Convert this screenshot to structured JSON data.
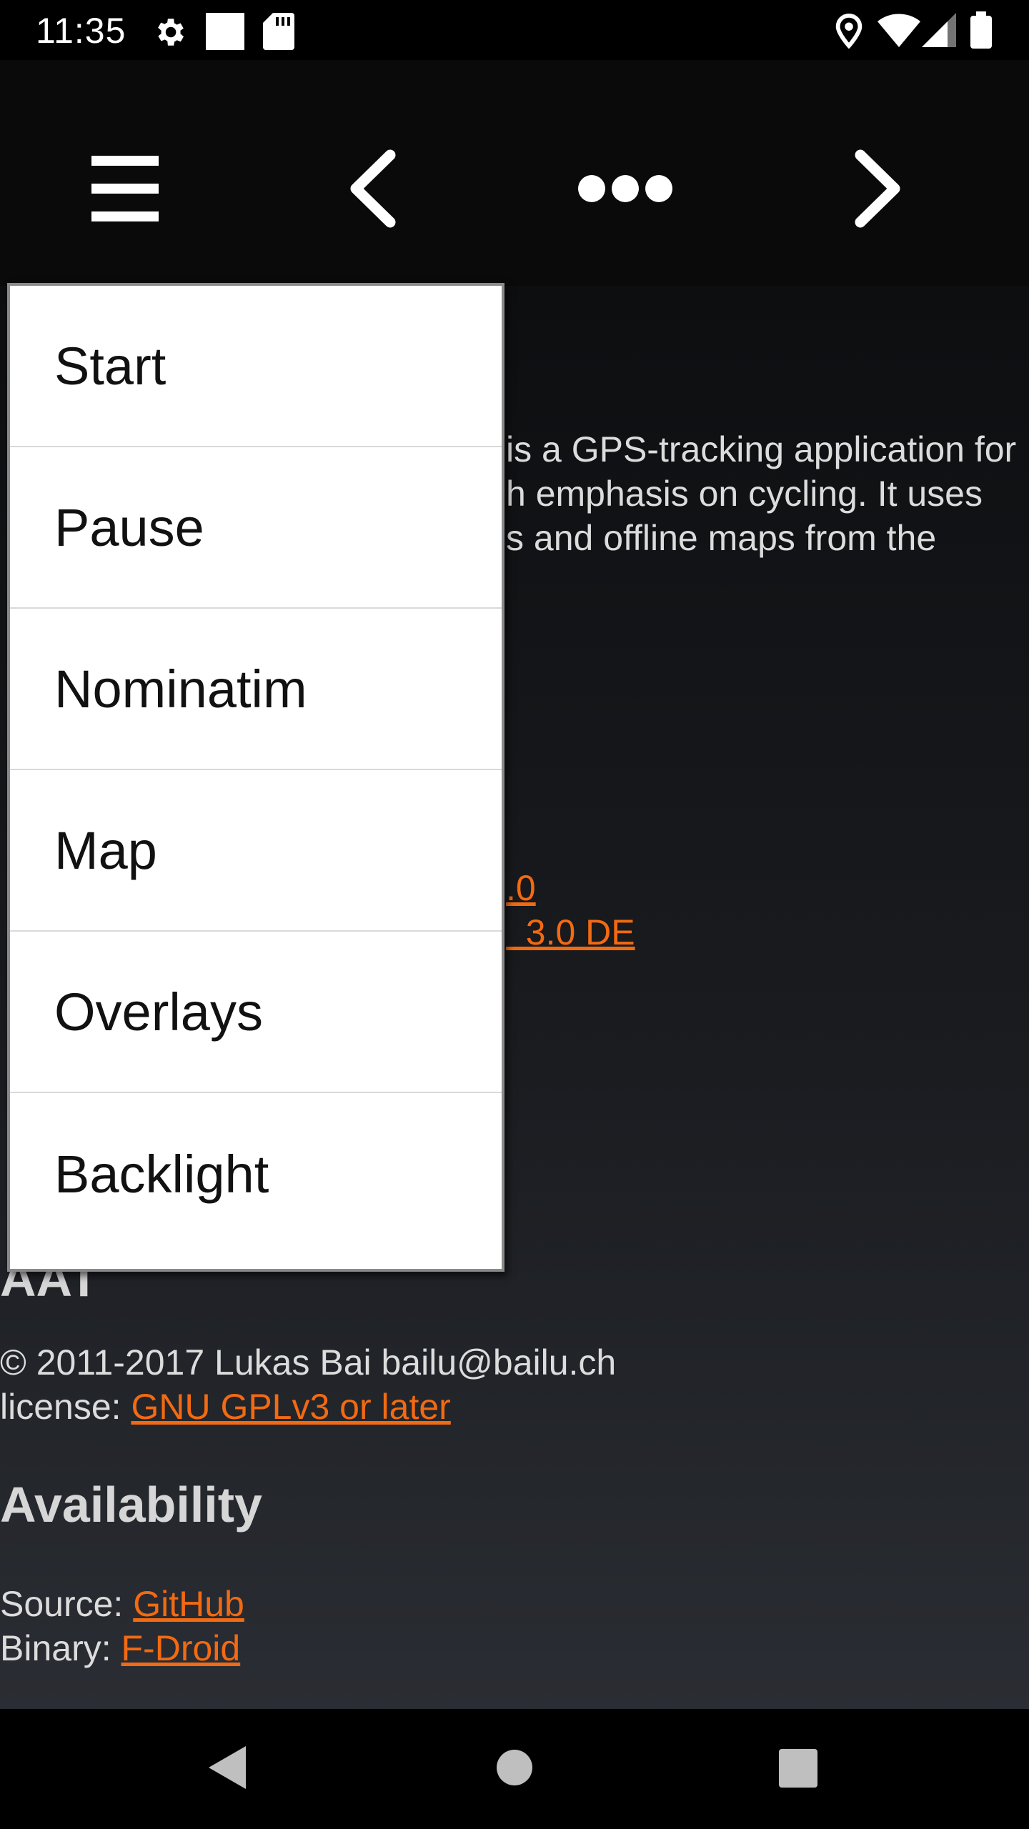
{
  "status_bar": {
    "time": "11:35",
    "left_icons": [
      "gear-icon",
      "square-icon",
      "sd-card-icon"
    ],
    "right_icons": [
      "location-icon",
      "wifi-icon",
      "signal-icon",
      "battery-icon"
    ]
  },
  "toolbar": {
    "buttons": [
      "menu-icon",
      "back-arrow-icon",
      "more-icon",
      "forward-arrow-icon"
    ]
  },
  "about": {
    "intro_line1": "is a GPS-tracking application for",
    "intro_line2": "h emphasis on cycling. It uses",
    "intro_line3": "s and offline maps from the",
    "partial_link1": ".0",
    "partial_link2": "  3.0 DE",
    "aat_heading_partial": "AAT",
    "copyright": "© 2011-2017 Lukas Bai bailu@bailu.ch",
    "license_label": "license: ",
    "license_link": "GNU GPLv3 or later",
    "availability_heading": "Availability",
    "source_label": "Source: ",
    "source_link": "GitHub",
    "binary_label": "Binary: ",
    "binary_link": "F-Droid"
  },
  "menu": {
    "items": [
      {
        "label": "Start"
      },
      {
        "label": "Pause"
      },
      {
        "label": "Nominatim"
      },
      {
        "label": "Map"
      },
      {
        "label": "Overlays"
      },
      {
        "label": "Backlight"
      }
    ]
  },
  "nav_bar": {
    "buttons": [
      "back-triangle-icon",
      "home-circle-icon",
      "recents-square-icon"
    ]
  },
  "colors": {
    "link": "#f26a12",
    "background": "#000000",
    "menu_background": "#ffffff"
  }
}
